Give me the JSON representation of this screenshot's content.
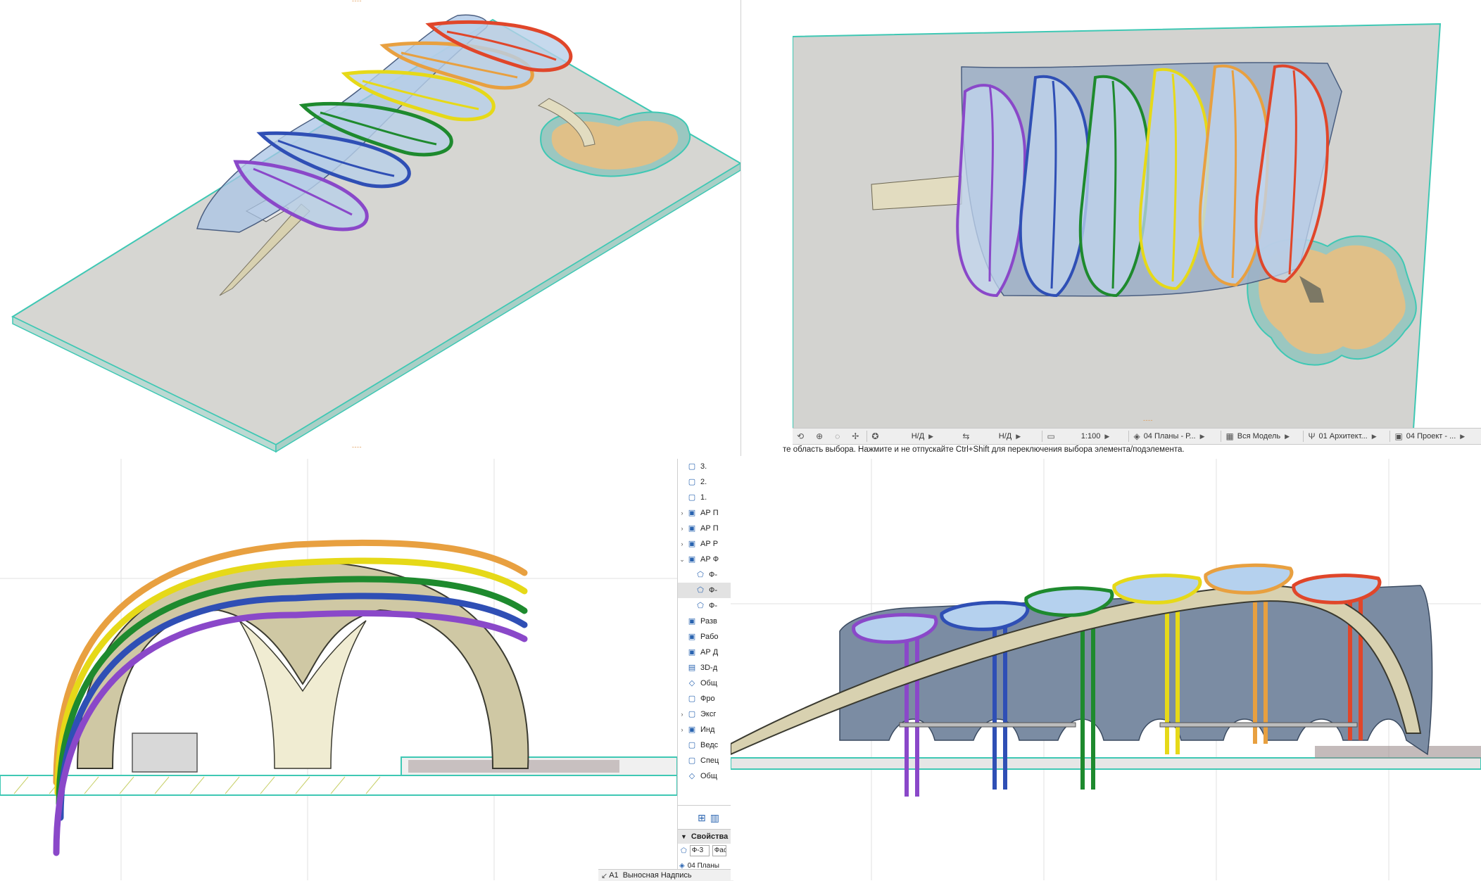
{
  "status_bar": {
    "na_1": "Н/Д",
    "na_2": "Н/Д",
    "scale": "1:100",
    "plan": "04 Планы - Р...",
    "model": "Вся Модель",
    "layer": "01 Архитект...",
    "project": "04 Проект - ..."
  },
  "hint": "те область выбора. Нажмите и не отпускайте Ctrl+Shift для переключения выбора элемента/подэлемента.",
  "navigator": {
    "items": [
      {
        "label": "3.",
        "chevron": "",
        "icon": "folder-icon"
      },
      {
        "label": "2.",
        "chevron": "",
        "icon": "folder-icon"
      },
      {
        "label": "1.",
        "chevron": "",
        "icon": "folder-icon"
      },
      {
        "label": "АР П",
        "chevron": ">",
        "icon": "layout-icon"
      },
      {
        "label": "АР П",
        "chevron": ">",
        "icon": "layout-icon"
      },
      {
        "label": "АР Р",
        "chevron": ">",
        "icon": "layout-icon"
      },
      {
        "label": "АР Ф",
        "chevron": "v",
        "icon": "layout-icon"
      },
      {
        "label": "Ф-",
        "chevron": "",
        "icon": "elevation-icon"
      },
      {
        "label": "Ф-",
        "chevron": "",
        "icon": "elevation-icon"
      },
      {
        "label": "Ф-",
        "chevron": "",
        "icon": "elevation-icon"
      },
      {
        "label": "Разв",
        "chevron": "",
        "icon": "layout-icon"
      },
      {
        "label": "Рабо",
        "chevron": "",
        "icon": "layout-icon"
      },
      {
        "label": "АР Д",
        "chevron": "",
        "icon": "layout-icon"
      },
      {
        "label": "3D-д",
        "chevron": "",
        "icon": "3d-document-icon"
      },
      {
        "label": "Общ",
        "chevron": "",
        "icon": "cube-icon"
      },
      {
        "label": "Фро",
        "chevron": "",
        "icon": "folder-icon"
      },
      {
        "label": "Эксг",
        "chevron": ">",
        "icon": "folder-icon"
      },
      {
        "label": "Инд",
        "chevron": ">",
        "icon": "layout-icon"
      },
      {
        "label": "Ведс",
        "chevron": "",
        "icon": "folder-icon"
      },
      {
        "label": "Спец",
        "chevron": "",
        "icon": "folder-icon"
      },
      {
        "label": "Общ",
        "chevron": "",
        "icon": "cube-icon"
      }
    ],
    "selected_index": 8
  },
  "properties": {
    "title": "Свойства",
    "id_value": "Ф-3",
    "type_value": "Фас",
    "plan_value": "04 Планы"
  },
  "callout": {
    "code": "А1",
    "label": "Выносная Надпись"
  },
  "colors": {
    "ground": "#d6d6d2",
    "ground_edge": "#3fc8b4",
    "sand": "#e0c088",
    "glass": "#a9c4e6",
    "beam": "#d8d1b0",
    "rainbow": [
      "#8a48c9",
      "#2f4fb5",
      "#1e8a2e",
      "#e6d918",
      "#e8a040",
      "#e0462a"
    ]
  }
}
